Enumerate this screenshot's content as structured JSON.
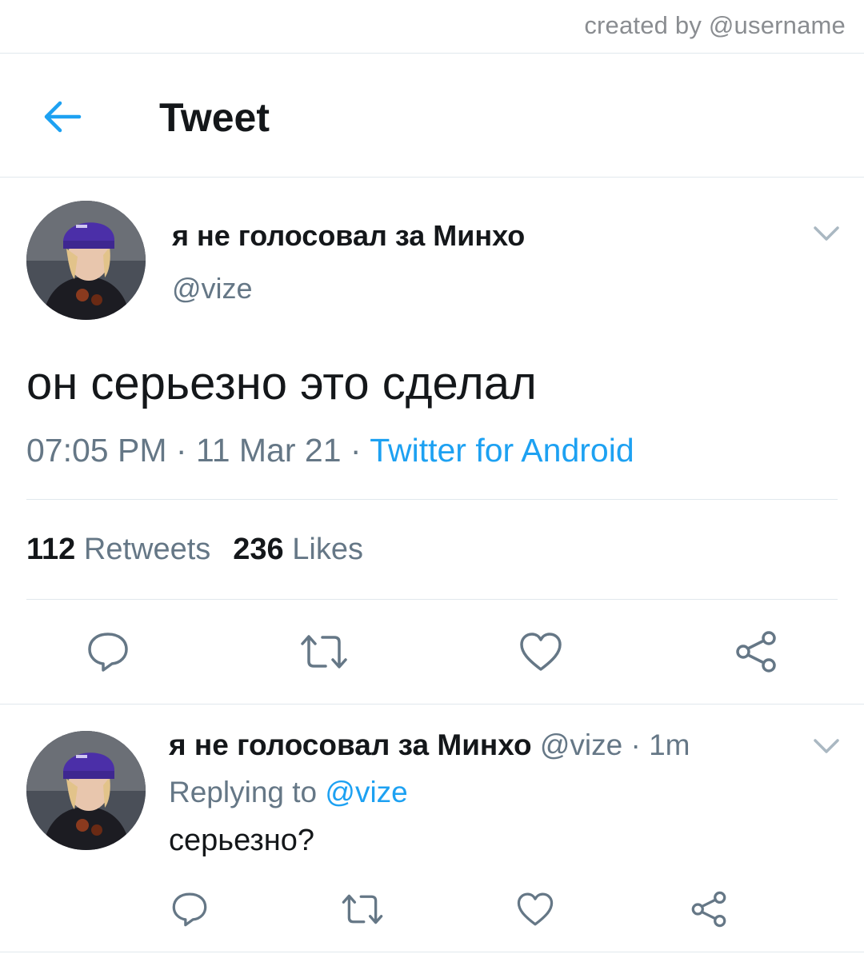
{
  "credit": "created by @username",
  "header": {
    "title": "Tweet",
    "back_icon": "arrow-left-icon"
  },
  "tweet": {
    "display_name": "я не голосовал за Минхо",
    "handle": "@vize",
    "text": "он серьезно это сделал",
    "time": "07:05 PM",
    "separator": " · ",
    "date": "11 Mar 21",
    "source": "Twitter for Android",
    "retweets_count": "112",
    "retweets_label": "Retweets",
    "likes_count": "236",
    "likes_label": "Likes",
    "actions": [
      "reply-icon",
      "retweet-icon",
      "like-icon",
      "share-icon"
    ]
  },
  "reply": {
    "display_name": "я не голосовал за Минхо",
    "handle": "@vize",
    "separator": " · ",
    "time": "1m",
    "replying_prefix": "Replying to ",
    "replying_handle": "@vize",
    "text": "серьезно?"
  },
  "colors": {
    "accent": "#1da1f2",
    "muted": "#657786",
    "text": "#14171a",
    "divider": "#e1e8ed"
  }
}
